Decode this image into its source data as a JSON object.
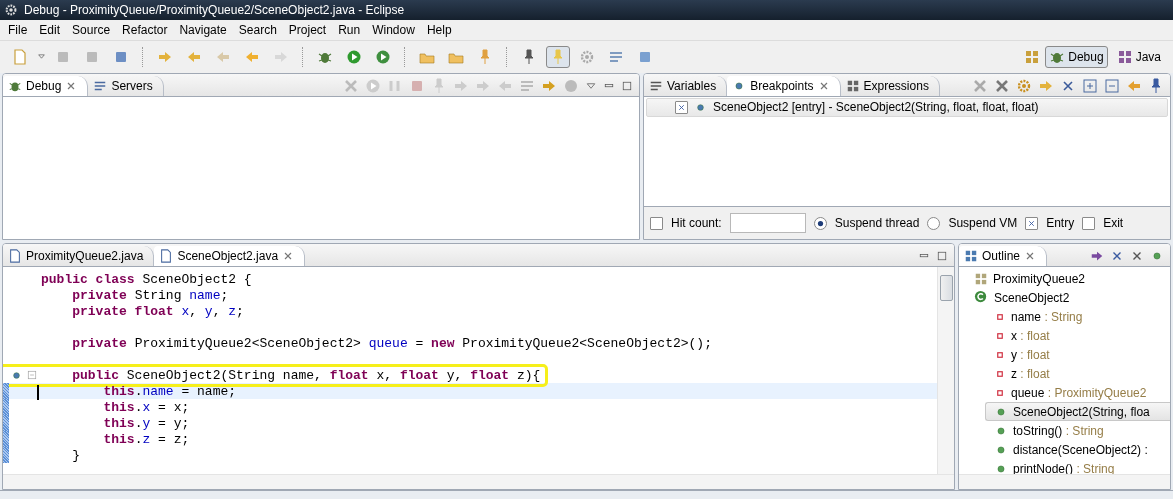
{
  "window": {
    "title": "Debug - ProximityQueue/ProximityQueue2/SceneObject2.java - Eclipse"
  },
  "menu": [
    "File",
    "Edit",
    "Source",
    "Refactor",
    "Navigate",
    "Search",
    "Project",
    "Run",
    "Window",
    "Help"
  ],
  "perspectives": [
    {
      "label": "Debug",
      "selected": true
    },
    {
      "label": "Java",
      "selected": false
    }
  ],
  "debug_panel": {
    "tabs": [
      {
        "label": "Debug",
        "selected": true
      },
      {
        "label": "Servers",
        "selected": false
      }
    ]
  },
  "breakpoints_panel": {
    "tabs": [
      {
        "label": "Variables",
        "selected": false
      },
      {
        "label": "Breakpoints",
        "selected": true
      },
      {
        "label": "Expressions",
        "selected": false
      }
    ],
    "items": [
      {
        "label": "SceneObject2 [entry] - SceneObject2(String, float, float, float)",
        "checked": true
      }
    ],
    "options": [
      {
        "kind": "checkbox",
        "label": "Hit count:",
        "checked": false
      },
      {
        "kind": "field"
      },
      {
        "kind": "radio",
        "label": "Suspend thread",
        "checked": true
      },
      {
        "kind": "radio",
        "label": "Suspend VM",
        "checked": false
      },
      {
        "kind": "checkbox",
        "label": "Entry",
        "checked": true
      },
      {
        "kind": "checkbox",
        "label": "Exit",
        "checked": false
      }
    ]
  },
  "editor": {
    "tabs": [
      {
        "label": "ProximityQueue2.java",
        "selected": false
      },
      {
        "label": "SceneObject2.java",
        "selected": true
      }
    ],
    "lines": [
      {
        "kind": "code",
        "tokens": [
          {
            "kind": "keyword",
            "text": "public class"
          },
          {
            "kind": "plain",
            "text": " SceneObject2 {"
          }
        ]
      },
      {
        "kind": "code",
        "tokens": [
          {
            "kind": "keyword",
            "text": "    private"
          },
          {
            "kind": "plain",
            "text": " String "
          },
          {
            "kind": "field",
            "text": "name"
          },
          {
            "kind": "plain",
            "text": ";"
          }
        ]
      },
      {
        "kind": "code",
        "tokens": [
          {
            "kind": "keyword",
            "text": "    private float"
          },
          {
            "kind": "field",
            "text": " x"
          },
          {
            "kind": "plain",
            "text": ", "
          },
          {
            "kind": "field",
            "text": "y"
          },
          {
            "kind": "plain",
            "text": ", "
          },
          {
            "kind": "field",
            "text": "z"
          },
          {
            "kind": "plain",
            "text": ";"
          }
        ]
      },
      {
        "kind": "blank"
      },
      {
        "kind": "code",
        "tokens": [
          {
            "kind": "keyword",
            "text": "    private"
          },
          {
            "kind": "plain",
            "text": " ProximityQueue2<SceneObject2> "
          },
          {
            "kind": "field",
            "text": "queue"
          },
          {
            "kind": "plain",
            "text": " = "
          },
          {
            "kind": "keyword",
            "text": "new"
          },
          {
            "kind": "plain",
            "text": " ProximityQueue2<SceneObject2>();"
          }
        ]
      },
      {
        "kind": "blank"
      },
      {
        "kind": "code",
        "breakpoint": true,
        "foldable": true,
        "annotated": true,
        "tokens": [
          {
            "kind": "keyword",
            "text": "    public"
          },
          {
            "kind": "plain",
            "text": " SceneObject2(String name, "
          },
          {
            "kind": "keyword",
            "text": "float"
          },
          {
            "kind": "plain",
            "text": " x, "
          },
          {
            "kind": "keyword",
            "text": "float"
          },
          {
            "kind": "plain",
            "text": " y, "
          },
          {
            "kind": "keyword",
            "text": "float"
          },
          {
            "kind": "plain",
            "text": " z){"
          }
        ]
      },
      {
        "kind": "code",
        "current": true,
        "changed": true,
        "tokens": [
          {
            "kind": "keyword",
            "text": "        this"
          },
          {
            "kind": "plain",
            "text": "."
          },
          {
            "kind": "field",
            "text": "name"
          },
          {
            "kind": "plain",
            "text": " = name;"
          }
        ]
      },
      {
        "kind": "code",
        "changed": true,
        "tokens": [
          {
            "kind": "keyword",
            "text": "        this"
          },
          {
            "kind": "plain",
            "text": "."
          },
          {
            "kind": "field",
            "text": "x"
          },
          {
            "kind": "plain",
            "text": " = x;"
          }
        ]
      },
      {
        "kind": "code",
        "changed": true,
        "tokens": [
          {
            "kind": "keyword",
            "text": "        this"
          },
          {
            "kind": "plain",
            "text": "."
          },
          {
            "kind": "field",
            "text": "y"
          },
          {
            "kind": "plain",
            "text": " = y;"
          }
        ]
      },
      {
        "kind": "code",
        "changed": true,
        "tokens": [
          {
            "kind": "keyword",
            "text": "        this"
          },
          {
            "kind": "plain",
            "text": "."
          },
          {
            "kind": "field",
            "text": "z"
          },
          {
            "kind": "plain",
            "text": " = z;"
          }
        ]
      },
      {
        "kind": "code",
        "changed": true,
        "tokens": [
          {
            "kind": "plain",
            "text": "    }"
          }
        ]
      }
    ]
  },
  "outline": {
    "tab": {
      "label": "Outline",
      "selected": true
    },
    "tree": [
      {
        "kind": "import",
        "label": "ProximityQueue2",
        "selected": false
      },
      {
        "kind": "class",
        "label": "SceneObject2",
        "selected": false,
        "children": [
          {
            "kind": "field",
            "label": "name",
            "type": ": String",
            "selected": false
          },
          {
            "kind": "field",
            "label": "x",
            "type": ": float",
            "selected": false
          },
          {
            "kind": "field",
            "label": "y",
            "type": ": float",
            "selected": false
          },
          {
            "kind": "field",
            "label": "z",
            "type": ": float",
            "selected": false
          },
          {
            "kind": "field",
            "label": "queue",
            "type": ": ProximityQueue2",
            "selected": false
          },
          {
            "kind": "constructor",
            "label": "SceneObject2(String, floa",
            "selected": true
          },
          {
            "kind": "override",
            "label": "toString()",
            "type": ": String",
            "selected": false
          },
          {
            "kind": "method",
            "label": "distance(SceneObject2) :",
            "selected": false
          },
          {
            "kind": "method",
            "label": "printNode()",
            "type": ": String",
            "selected": false
          }
        ]
      }
    ]
  }
}
